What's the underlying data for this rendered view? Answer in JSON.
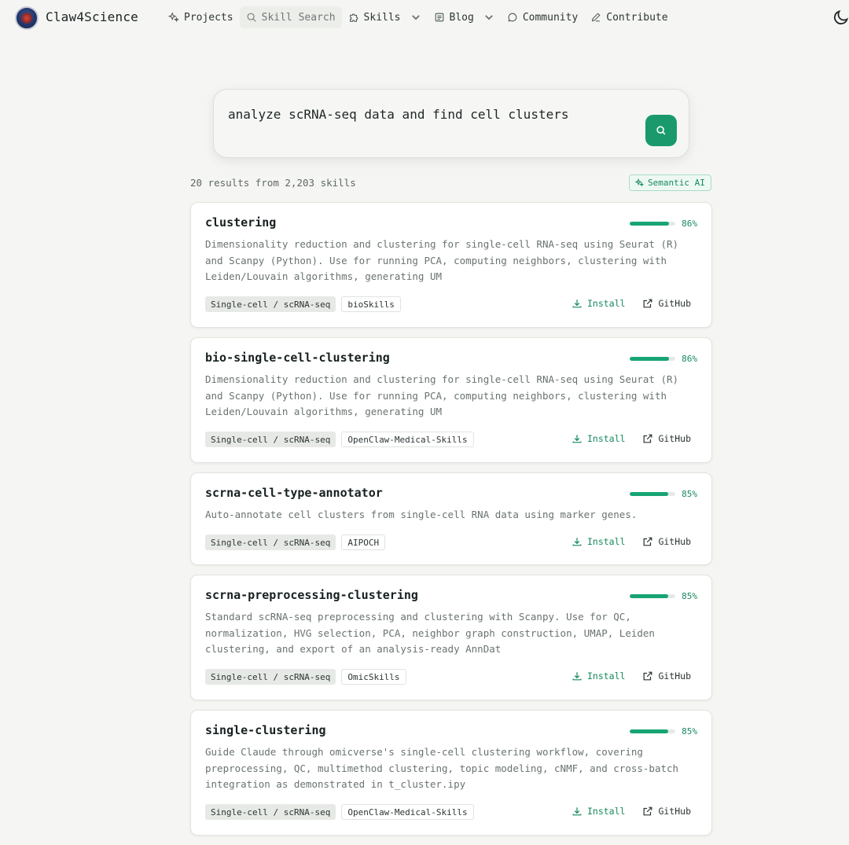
{
  "header": {
    "brand": "Claw4Science",
    "nav": [
      {
        "label": "Projects",
        "icon": "sparkles-icon"
      },
      {
        "label": "Skill Search",
        "icon": "search-icon",
        "active": true
      },
      {
        "label": "Skills",
        "icon": "puzzle-icon",
        "dropdown": true
      },
      {
        "label": "Blog",
        "icon": "book-icon",
        "dropdown": true
      },
      {
        "label": "Community",
        "icon": "chat-bubble-icon"
      },
      {
        "label": "Contribute",
        "icon": "pencil-icon"
      }
    ],
    "theme_icon": "moon-icon"
  },
  "search": {
    "query": "analyze scRNA-seq data and find cell clusters",
    "button_icon": "search-icon"
  },
  "results": {
    "summary": "20 results from 2,203 skills",
    "mode_badge": "Semantic AI"
  },
  "colors": {
    "accent": "#1a9a6c",
    "score_bar": "#17a573",
    "background": "#f5f6f3"
  },
  "cards": [
    {
      "title": "clustering",
      "score": "86%",
      "score_value": 0.86,
      "desc": "Dimensionality reduction and clustering for single-cell RNA-seq using Seurat (R) and Scanpy (Python). Use for running PCA, computing neighbors, clustering with Leiden/Louvain algorithms, generating UM",
      "category": "Single-cell / scRNA-seq",
      "source": "bioSkills",
      "install": "Install",
      "github": "GitHub"
    },
    {
      "title": "bio-single-cell-clustering",
      "score": "86%",
      "score_value": 0.86,
      "desc": "Dimensionality reduction and clustering for single-cell RNA-seq using Seurat (R) and Scanpy (Python). Use for running PCA, computing neighbors, clustering with Leiden/Louvain algorithms, generating UM",
      "category": "Single-cell / scRNA-seq",
      "source": "OpenClaw-Medical-Skills",
      "install": "Install",
      "github": "GitHub"
    },
    {
      "title": "scrna-cell-type-annotator",
      "score": "85%",
      "score_value": 0.85,
      "desc": "Auto-annotate cell clusters from single-cell RNA data using marker genes.",
      "category": "Single-cell / scRNA-seq",
      "source": "AIPOCH",
      "install": "Install",
      "github": "GitHub"
    },
    {
      "title": "scrna-preprocessing-clustering",
      "score": "85%",
      "score_value": 0.85,
      "desc": "Standard scRNA-seq preprocessing and clustering with Scanpy. Use for QC, normalization, HVG selection, PCA, neighbor graph construction, UMAP, Leiden clustering, and export of an analysis-ready AnnDat",
      "category": "Single-cell / scRNA-seq",
      "source": "OmicSkills",
      "install": "Install",
      "github": "GitHub"
    },
    {
      "title": "single-clustering",
      "score": "85%",
      "score_value": 0.85,
      "desc": "Guide Claude through omicverse's single-cell clustering workflow, covering preprocessing, QC, multimethod clustering, topic modeling, cNMF, and cross-batch integration as demonstrated in t_cluster.ipy",
      "category": "Single-cell / scRNA-seq",
      "source": "OpenClaw-Medical-Skills",
      "install": "Install",
      "github": "GitHub"
    }
  ]
}
